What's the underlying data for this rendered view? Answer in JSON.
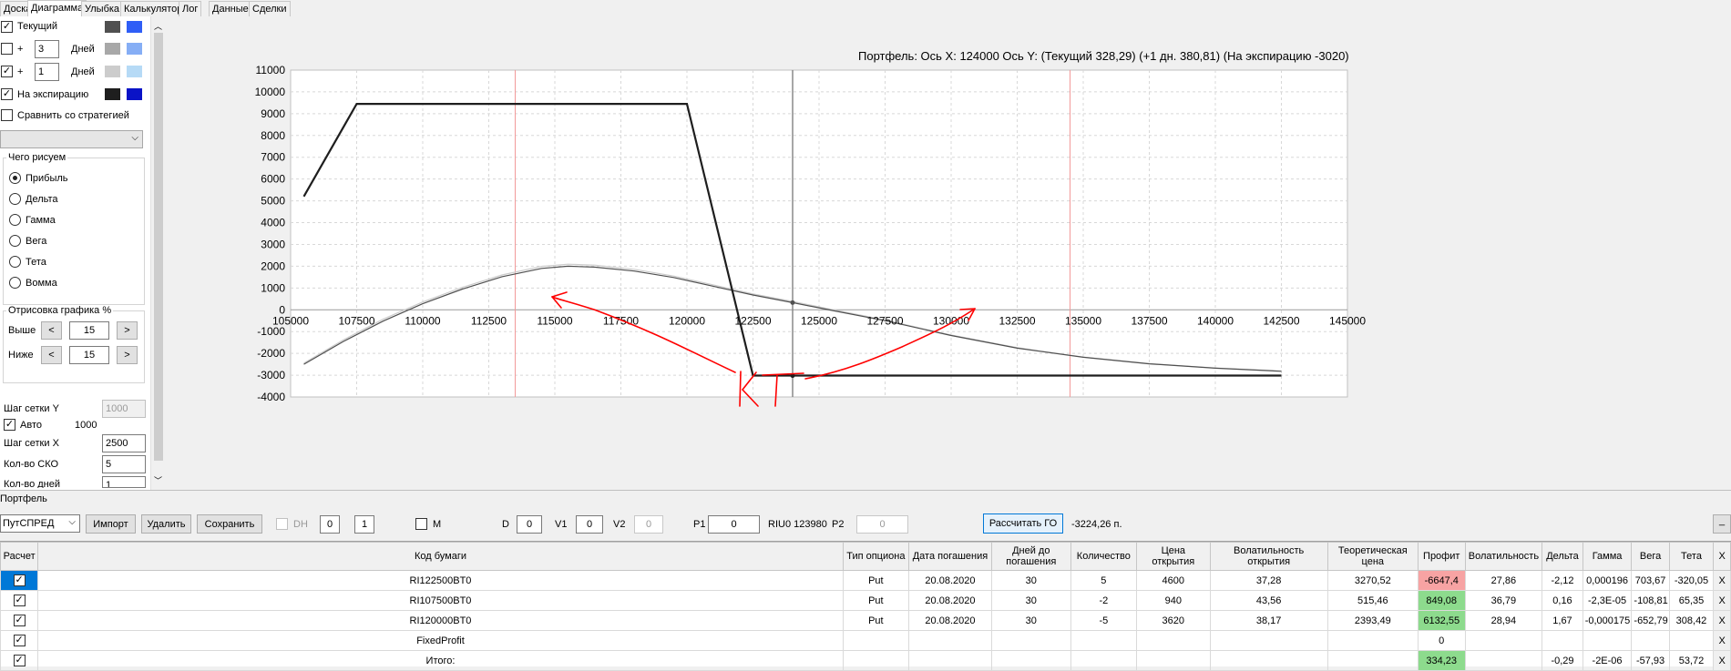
{
  "tabs": [
    "Доска",
    "Диаграмма",
    "Улыбка",
    "Калькулятор",
    "Лог",
    "Данные",
    "Сделки"
  ],
  "left": {
    "row_current": {
      "label": "Текущий",
      "checked": true,
      "color1": "#505050",
      "color2": "#2f5ef6"
    },
    "row_plus1": {
      "plus": "+",
      "value": "3",
      "unit": "Дней",
      "checked": false,
      "color1": "#a8a8a8",
      "color2": "#86aef5"
    },
    "row_plus2": {
      "plus": "+",
      "value": "1",
      "unit": "Дней",
      "checked": true,
      "color1": "#cccccc",
      "color2": "#b6daf6"
    },
    "row_expiry": {
      "label": "На экспирацию",
      "checked": true,
      "color1": "#1e1e1e",
      "color2": "#0a13c7"
    },
    "compare_label": "Сравнить со стратегией",
    "draw_group": {
      "title": "Чего рисуем",
      "options": [
        "Прибыль",
        "Дельта",
        "Гамма",
        "Вега",
        "Тета",
        "Вомма"
      ],
      "selected": "Прибыль"
    },
    "render_group": {
      "title": "Отрисовка графика %",
      "above_label": "Выше",
      "above_value": "15",
      "below_label": "Ниже",
      "below_value": "15",
      "dec": "<",
      "inc": ">"
    },
    "grid_y_label": "Шаг сетки Y",
    "grid_y_value": "1000",
    "auto_label": "Авто",
    "auto_value": "1000",
    "auto_checked": true,
    "grid_x_label": "Шаг сетки X",
    "grid_x_value": "2500",
    "sko_label": "Кол-во СКО",
    "sko_value": "5",
    "days_label": "Кол-во дней",
    "days_value": "1"
  },
  "chart_title": "Портфель: Ось X: 124000 Ось Y:  (Текущий 328,29)  (+1 дн. 380,81)  (На экспирацию -3020)",
  "chart_data": {
    "type": "line",
    "xlim": [
      105000,
      145000
    ],
    "ylim": [
      -4000,
      11000
    ],
    "x_ticks": [
      105000,
      107500,
      110000,
      112500,
      115000,
      117500,
      120000,
      122500,
      125000,
      127500,
      130000,
      132500,
      135000,
      137500,
      140000,
      142500,
      145000
    ],
    "y_ticks": [
      11000,
      10000,
      9000,
      8000,
      7000,
      6000,
      5000,
      4000,
      3000,
      2000,
      1000,
      0,
      -1000,
      -2000,
      -3000,
      -4000
    ],
    "grid": true,
    "cursor_x": 124000,
    "sd_lines_x": [
      113500,
      134500
    ],
    "series": [
      {
        "name": "На экспирацию",
        "color": "#1e1e1e",
        "width": 2.2,
        "x": [
          105500,
          107500,
          108000,
          120000,
          122500,
          142500
        ],
        "y": [
          5200,
          9450,
          9450,
          9450,
          -3020,
          -3020
        ]
      },
      {
        "name": "Текущий",
        "color": "#505050",
        "width": 1.2,
        "x": [
          105500,
          107000,
          108500,
          110000,
          111500,
          113000,
          114500,
          115500,
          116500,
          118000,
          119500,
          121000,
          122500,
          124000,
          125500,
          127500,
          130000,
          132500,
          135000,
          137500,
          140000,
          142500
        ],
        "y": [
          -2500,
          -1450,
          -520,
          280,
          950,
          1520,
          1900,
          2000,
          1960,
          1780,
          1480,
          1080,
          680,
          328,
          -30,
          -500,
          -1180,
          -1760,
          -2180,
          -2480,
          -2680,
          -2820
        ]
      },
      {
        "name": "+1 дн.",
        "color": "#cccccc",
        "width": 1.2,
        "x": [
          105500,
          107000,
          108500,
          110000,
          111500,
          113000,
          114500,
          115500,
          116500,
          118000,
          119500,
          121000,
          122500,
          124000,
          125500,
          127500,
          130000,
          132500,
          135000,
          137500,
          140000,
          142500
        ],
        "y": [
          -2450,
          -1380,
          -430,
          360,
          1030,
          1600,
          1990,
          2090,
          2050,
          1860,
          1550,
          1140,
          730,
          381,
          10,
          -470,
          -1160,
          -1740,
          -2170,
          -2470,
          -2670,
          -2810
        ]
      }
    ]
  },
  "annotation": {
    "text": "КТ",
    "color": "#ff0000"
  },
  "bottom": {
    "portfolio_label": "Портфель",
    "strategy_select": "ПутСПРЕД",
    "import": "Импорт",
    "delete": "Удалить",
    "save": "Сохранить",
    "dh_label": "DH",
    "dh_v1": "0",
    "dh_v2": "1",
    "m_label": "M",
    "d_label": "D",
    "d_value": "0",
    "v1_label": "V1",
    "v1_value": "0",
    "v2_label": "V2",
    "v2_value": "0",
    "p1_label": "P1",
    "p1_value": "0",
    "riu_label": "RIU0 123980",
    "p2_label": "P2",
    "p2_value": "0",
    "calc_go": "Рассчитать ГО",
    "go_value": "-3224,26 п.",
    "min_button": "_"
  },
  "table": {
    "headers": [
      "Расчет",
      "Код бумаги",
      "Тип опциона",
      "Дата погашения",
      "Дней до погашения",
      "Количество",
      "Цена открытия",
      "Волатильность открытия",
      "Теоретическая цена",
      "Профит",
      "Волатильность",
      "Дельта",
      "Гамма",
      "Вега",
      "Тета",
      "X"
    ],
    "rows": [
      {
        "code": "RI122500BT0",
        "type": "Put",
        "date": "20.08.2020",
        "days": "30",
        "qty": "5",
        "price": "4600",
        "vol_open": "37,28",
        "theo": "3270,52",
        "profit": "-6647,4",
        "profit_state": "neg",
        "vol": "27,86",
        "delta": "-2,12",
        "gamma": "0,000196",
        "vega": "703,67",
        "theta": "-320,05",
        "x": "X"
      },
      {
        "code": "RI107500BT0",
        "type": "Put",
        "date": "20.08.2020",
        "days": "30",
        "qty": "-2",
        "price": "940",
        "vol_open": "43,56",
        "theo": "515,46",
        "profit": "849,08",
        "profit_state": "pos",
        "vol": "36,79",
        "delta": "0,16",
        "gamma": "-2,3E-05",
        "vega": "-108,81",
        "theta": "65,35",
        "x": "X"
      },
      {
        "code": "RI120000BT0",
        "type": "Put",
        "date": "20.08.2020",
        "days": "30",
        "qty": "-5",
        "price": "3620",
        "vol_open": "38,17",
        "theo": "2393,49",
        "profit": "6132,55",
        "profit_state": "pos",
        "vol": "28,94",
        "delta": "1,67",
        "gamma": "-0,000175",
        "vega": "-652,79",
        "theta": "308,42",
        "x": "X"
      },
      {
        "code": "FixedProfit",
        "type": "",
        "date": "",
        "days": "",
        "qty": "",
        "price": "",
        "vol_open": "",
        "theo": "",
        "profit": "0",
        "profit_state": "",
        "vol": "",
        "delta": "",
        "gamma": "",
        "vega": "",
        "theta": "",
        "x": "X"
      },
      {
        "code": "Итого:",
        "type": "",
        "date": "",
        "days": "",
        "qty": "",
        "price": "",
        "vol_open": "",
        "theo": "",
        "profit": "334,23",
        "profit_state": "pos",
        "vol": "",
        "delta": "-0,29",
        "gamma": "-2E-06",
        "vega": "-57,93",
        "theta": "53,72",
        "x": "X"
      }
    ]
  }
}
